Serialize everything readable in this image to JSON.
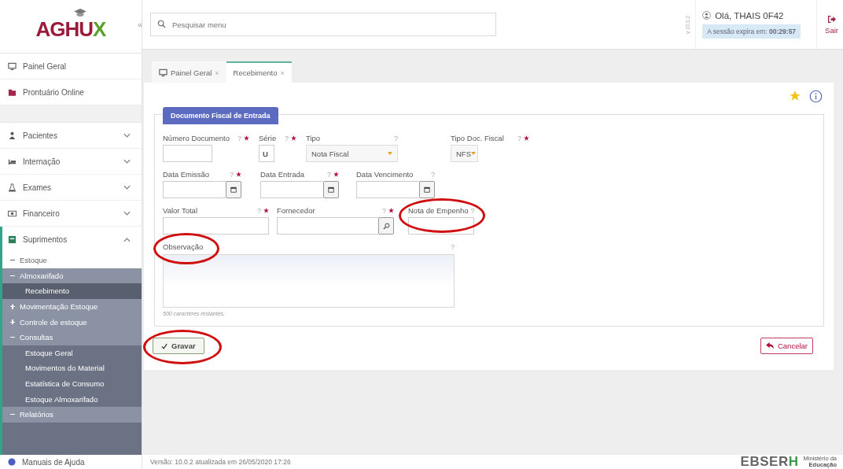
{
  "logo": {
    "text": "AGHU",
    "accent": "X"
  },
  "collapse": "«",
  "search": {
    "placeholder": "Pesquisar menu"
  },
  "version_tag": "v 10.0.2",
  "user": {
    "greeting": "Olá, THAIS 0F42",
    "session": "A sessão expira em: **00:29:57**"
  },
  "logout": "Sair",
  "sidebar": {
    "items": [
      {
        "label": "Painel Geral",
        "kind": "link"
      },
      {
        "label": "Prontuário Online",
        "kind": "link"
      },
      {
        "kind": "spacer"
      },
      {
        "label": "Pacientes",
        "kind": "menu",
        "expanded": false
      },
      {
        "label": "Internação",
        "kind": "menu",
        "expanded": false
      },
      {
        "label": "Exames",
        "kind": "menu",
        "expanded": false
      },
      {
        "label": "Financeiro",
        "kind": "menu",
        "expanded": false
      },
      {
        "label": "Suprimentos",
        "kind": "menu",
        "expanded": true,
        "children": [
          {
            "label": "Estoque",
            "expanded": true,
            "children": [
              {
                "label": "Almoxarifado",
                "expanded": true,
                "children": [
                  {
                    "label": "Recebimento",
                    "selected": true
                  }
                ]
              },
              {
                "label": "Movimentação Estoque",
                "expanded": false
              },
              {
                "label": "Controle de estoque",
                "expanded": false
              },
              {
                "label": "Consultas",
                "expanded": true,
                "children": [
                  {
                    "label": "Estoque Geral",
                    "selected": false
                  },
                  {
                    "label": "Movimentos do Material",
                    "selected": false
                  },
                  {
                    "label": "Estatística de Consumo",
                    "selected": false
                  },
                  {
                    "label": "Estoque Almoxarifado",
                    "selected": false
                  }
                ]
              },
              {
                "label": "Relatórios",
                "expanded": true
              }
            ]
          }
        ]
      }
    ],
    "help": "Manuais de Ajuda"
  },
  "tabs": [
    {
      "label": "Painel Geral",
      "close": "×",
      "selected": false
    },
    {
      "label": "Recebimento",
      "close": "×",
      "selected": true
    }
  ],
  "form": {
    "legend": "Documento Fiscal de Entrada",
    "rows": [
      [
        {
          "label": "Número Documento",
          "help": "?",
          "required": true,
          "kind": "text"
        },
        {
          "label": "Série",
          "help": "?",
          "required": true,
          "kind": "text",
          "value": "U"
        },
        {
          "label": "Tipo",
          "help": "?",
          "required": false,
          "kind": "select",
          "value": "Nota Fiscal"
        },
        {
          "label": "Tipo Doc. Fiscal",
          "help": "?",
          "required": true,
          "kind": "select",
          "value": "NFS"
        }
      ],
      [
        {
          "label": "Data Emissão",
          "help": "?",
          "required": true,
          "kind": "date"
        },
        {
          "label": "Data Entrada",
          "help": "?",
          "required": true,
          "kind": "date"
        },
        {
          "label": "Data Vencimento",
          "help": "?",
          "required": false,
          "kind": "date"
        }
      ],
      [
        {
          "label": "Valor Total",
          "help": "?",
          "required": true,
          "kind": "text"
        },
        {
          "label": "Fornecedor",
          "help": "?",
          "required": true,
          "kind": "lookup"
        },
        {
          "label": "Nota de Empenho",
          "help": "?",
          "required": false,
          "kind": "text",
          "circled": true
        }
      ]
    ],
    "notes": {
      "label": "Observação",
      "help": "?",
      "circled": true,
      "counter": "500 caracteres restantes."
    },
    "save": {
      "label": "Gravar",
      "circled": true
    },
    "cancel": {
      "label": "Cancelar"
    }
  },
  "footer": {
    "version": "Versão: 10.0.2 atualizada em 26/05/2020 17:26",
    "brand": "EBSER",
    "brand_accent": "H",
    "ministry": [
      "Ministério da",
      "Educação"
    ]
  }
}
